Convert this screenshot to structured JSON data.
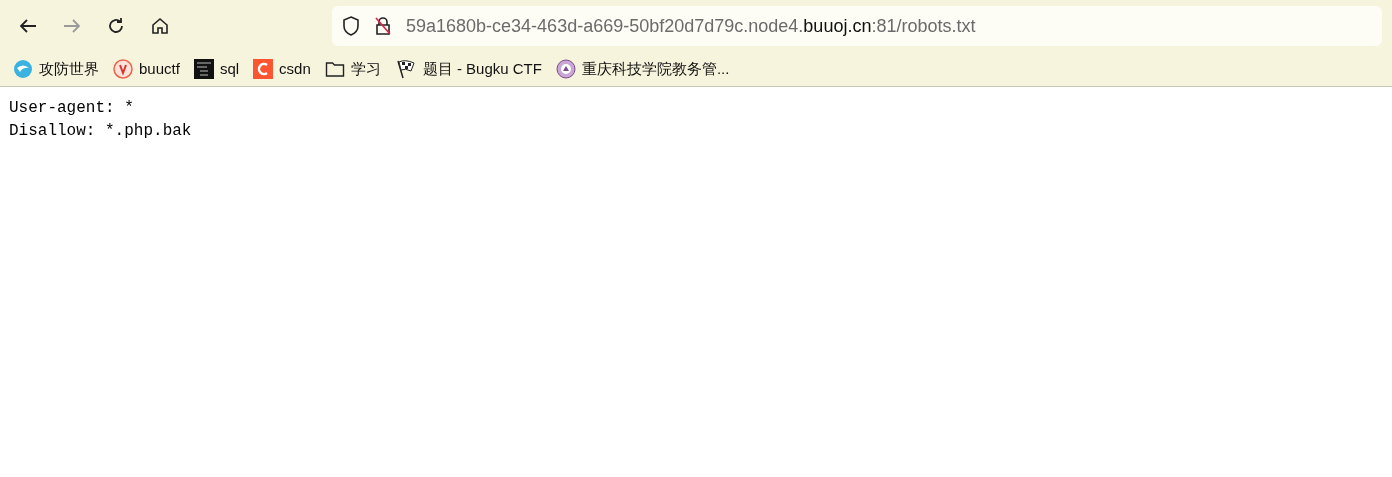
{
  "toolbar": {
    "url": {
      "prefix": "59a1680b-ce34-463d-a669-50bf20d7d79c.node4.",
      "domain": "buuoj.cn",
      "suffix": ":81/robots.txt"
    },
    "forward_disabled": true
  },
  "bookmarks": [
    {
      "kind": "globe",
      "label": "攻防世界"
    },
    {
      "kind": "seal",
      "label": "buuctf"
    },
    {
      "kind": "hack",
      "label": "sql"
    },
    {
      "kind": "c",
      "label": "csdn"
    },
    {
      "kind": "folder",
      "label": "学习"
    },
    {
      "kind": "flag",
      "label": "题目 - Bugku CTF"
    },
    {
      "kind": "emblem",
      "label": "重庆科技学院教务管..."
    }
  ],
  "page": {
    "lines": [
      "User-agent: *",
      "Disallow: *.php.bak"
    ]
  }
}
